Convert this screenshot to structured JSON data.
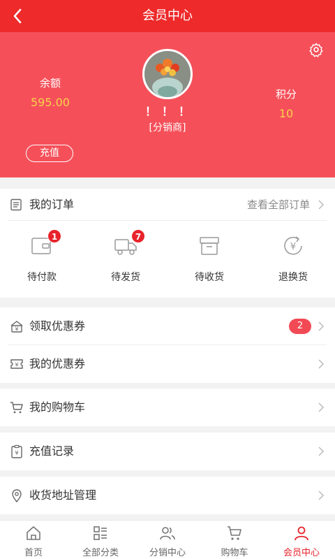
{
  "colors": {
    "primary": "#ee2a2a",
    "header_bg": "#f5505a",
    "accent_value": "#f8d24a",
    "badge": "#e8232b"
  },
  "titlebar": {
    "title": "会员中心",
    "back_icon": "chevron-left-icon"
  },
  "profile": {
    "settings_icon": "gear-icon",
    "balance_label": "余额",
    "balance_value": "595.00",
    "recharge_label": "充值",
    "username": "！！！",
    "role": "[分销商]",
    "points_label": "积分",
    "points_value": "10"
  },
  "orders": {
    "title": "我的订单",
    "view_all": "查看全部订单",
    "items": [
      {
        "label": "待付款",
        "badge": "1",
        "icon": "wallet-icon"
      },
      {
        "label": "待发货",
        "badge": "7",
        "icon": "truck-icon"
      },
      {
        "label": "待收货",
        "badge": "",
        "icon": "box-icon"
      },
      {
        "label": "退换货",
        "badge": "",
        "icon": "refund-icon"
      }
    ]
  },
  "menu": {
    "claim_coupons": {
      "label": "领取优惠券",
      "count": "2"
    },
    "my_coupons": {
      "label": "我的优惠券"
    },
    "my_cart": {
      "label": "我的购物车"
    },
    "recharge_records": {
      "label": "充值记录"
    },
    "address": {
      "label": "收货地址管理"
    }
  },
  "tabbar": {
    "tabs": [
      {
        "label": "首页",
        "icon": "home-icon"
      },
      {
        "label": "全部分类",
        "icon": "category-icon"
      },
      {
        "label": "分销中心",
        "icon": "users-icon"
      },
      {
        "label": "购物车",
        "icon": "cart-icon"
      },
      {
        "label": "会员中心",
        "icon": "user-icon",
        "active": true
      }
    ]
  }
}
